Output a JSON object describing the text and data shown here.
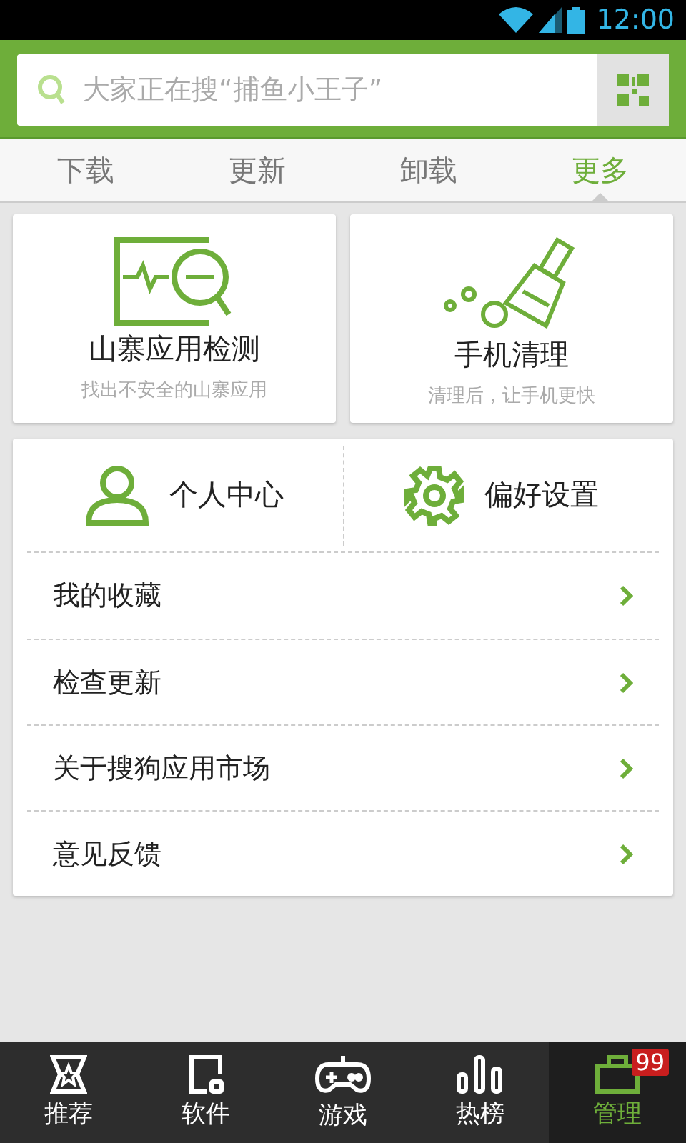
{
  "status_bar": {
    "time": "12:00"
  },
  "search": {
    "placeholder": "大家正在搜“捕鱼小王子”"
  },
  "tabs": [
    {
      "label": "下载",
      "selected": false
    },
    {
      "label": "更新",
      "selected": false
    },
    {
      "label": "卸载",
      "selected": false
    },
    {
      "label": "更多",
      "selected": true
    }
  ],
  "feature_cards": [
    {
      "kind": "detect",
      "title": "山寨应用检测",
      "subtitle": "找出不安全的山寨应用"
    },
    {
      "kind": "clean",
      "title": "手机清理",
      "subtitle": "清理后，让手机更快"
    }
  ],
  "shortcuts": [
    {
      "kind": "user",
      "label": "个人中心"
    },
    {
      "kind": "settings",
      "label": "偏好设置"
    }
  ],
  "menu_items": [
    {
      "label": "我的收藏"
    },
    {
      "label": "检查更新"
    },
    {
      "label": "关于搜狗应用市场"
    },
    {
      "label": "意见反馈"
    }
  ],
  "bottom_nav": [
    {
      "kind": "recommend",
      "label": "推荐",
      "selected": false
    },
    {
      "kind": "software",
      "label": "软件",
      "selected": false
    },
    {
      "kind": "games",
      "label": "游戏",
      "selected": false
    },
    {
      "kind": "charts",
      "label": "热榜",
      "selected": false
    },
    {
      "kind": "manage",
      "label": "管理",
      "selected": true,
      "badge": "99"
    }
  ]
}
